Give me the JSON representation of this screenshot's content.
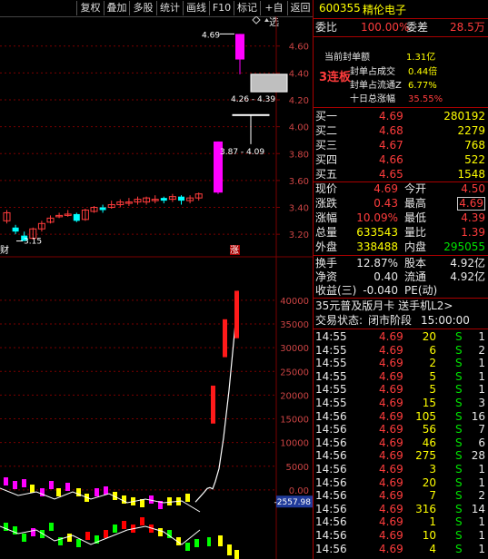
{
  "toolbar": [
    "复权",
    "叠加",
    "多股",
    "统计",
    "画线",
    "F10",
    "标记",
    "+自选",
    "返回"
  ],
  "stock": {
    "code": "600355",
    "name": "精伦电子"
  },
  "weibi": {
    "label": "委比",
    "value": "100.00%",
    "diff_label": "委差",
    "diff": "28.5万"
  },
  "limit": {
    "badge": "3连板",
    "rows": [
      {
        "label": "当前封单额",
        "value": "1.31亿"
      },
      {
        "label": "封单占成交",
        "value": "0.44倍"
      },
      {
        "label": "封单占流通Z",
        "value": "6.77%"
      },
      {
        "label": "十日总涨幅",
        "value": "35.55%"
      }
    ]
  },
  "bids": [
    {
      "label": "买一",
      "price": "4.69",
      "vol": "280192"
    },
    {
      "label": "买二",
      "price": "4.68",
      "vol": "2279"
    },
    {
      "label": "买三",
      "price": "4.67",
      "vol": "768"
    },
    {
      "label": "买四",
      "price": "4.66",
      "vol": "522"
    },
    {
      "label": "买五",
      "price": "4.65",
      "vol": "1548"
    }
  ],
  "quote": [
    {
      "l1": "现价",
      "v1": "4.69",
      "l2": "今开",
      "v2": "4.50"
    },
    {
      "l1": "涨跌",
      "v1": "0.43",
      "l2": "最高",
      "v2": "4.69"
    },
    {
      "l1": "涨幅",
      "v1": "10.09%",
      "l2": "最低",
      "v2": "4.39"
    },
    {
      "l1": "总量",
      "v1": "633543",
      "l2": "量比",
      "v2": "1.39"
    },
    {
      "l1": "外盘",
      "v1": "338488",
      "l2": "内盘",
      "v2": "295055"
    }
  ],
  "fund": [
    {
      "l1": "换手",
      "v1": "12.87%",
      "l2": "股本",
      "v2": "4.92亿"
    },
    {
      "l1": "净资",
      "v1": "0.40",
      "l2": "流通",
      "v2": "4.92亿"
    },
    {
      "l1": "收益(三)",
      "v1": "-0.040",
      "l2": "PE(动)",
      "v2": ""
    }
  ],
  "promo": "35元普及版月卡 送手机L2>",
  "status": {
    "label": "交易状态:",
    "value": "闭市阶段",
    "time": "15:00:00"
  },
  "ticks": [
    {
      "t": "14:55",
      "p": "4.69",
      "v": "20",
      "s": "S",
      "n": "1"
    },
    {
      "t": "14:55",
      "p": "4.69",
      "v": "6",
      "s": "S",
      "n": "2"
    },
    {
      "t": "14:55",
      "p": "4.69",
      "v": "2",
      "s": "S",
      "n": "1"
    },
    {
      "t": "14:55",
      "p": "4.69",
      "v": "5",
      "s": "S",
      "n": "1"
    },
    {
      "t": "14:55",
      "p": "4.69",
      "v": "5",
      "s": "S",
      "n": "1"
    },
    {
      "t": "14:55",
      "p": "4.69",
      "v": "15",
      "s": "S",
      "n": "3"
    },
    {
      "t": "14:56",
      "p": "4.69",
      "v": "105",
      "s": "S",
      "n": "16"
    },
    {
      "t": "14:56",
      "p": "4.69",
      "v": "56",
      "s": "S",
      "n": "7"
    },
    {
      "t": "14:56",
      "p": "4.69",
      "v": "46",
      "s": "S",
      "n": "6"
    },
    {
      "t": "14:56",
      "p": "4.69",
      "v": "275",
      "s": "S",
      "n": "28"
    },
    {
      "t": "14:56",
      "p": "4.69",
      "v": "3",
      "s": "S",
      "n": "1"
    },
    {
      "t": "14:56",
      "p": "4.69",
      "v": "20",
      "s": "S",
      "n": "1"
    },
    {
      "t": "14:56",
      "p": "4.69",
      "v": "7",
      "s": "S",
      "n": "2"
    },
    {
      "t": "14:56",
      "p": "4.69",
      "v": "316",
      "s": "S",
      "n": "14"
    },
    {
      "t": "14:56",
      "p": "4.69",
      "v": "1",
      "s": "S",
      "n": "1"
    },
    {
      "t": "14:56",
      "p": "4.69",
      "v": "10",
      "s": "S",
      "n": "1"
    },
    {
      "t": "14:56",
      "p": "4.69",
      "v": "4",
      "s": "S",
      "n": "1"
    }
  ],
  "chart_data": [
    {
      "type": "candlestick",
      "y_ticks": [
        "4.60",
        "4.40",
        "4.20",
        "4.00",
        "3.80",
        "3.60",
        "3.40",
        "3.20"
      ],
      "ylim": [
        3.12,
        4.74
      ],
      "candles": [
        [
          3.3,
          3.36,
          3.28,
          3.38
        ],
        [
          3.25,
          3.22,
          3.2,
          3.27
        ],
        [
          3.19,
          3.15,
          3.15,
          3.22
        ],
        [
          3.17,
          3.24,
          3.16,
          3.25
        ],
        [
          3.24,
          3.28,
          3.22,
          3.3
        ],
        [
          3.29,
          3.32,
          3.28,
          3.34
        ],
        [
          3.33,
          3.34,
          3.32,
          3.36
        ],
        [
          3.34,
          3.35,
          3.33,
          3.38
        ],
        [
          3.35,
          3.3,
          3.29,
          3.36
        ],
        [
          3.31,
          3.38,
          3.3,
          3.39
        ],
        [
          3.37,
          3.4,
          3.36,
          3.41
        ],
        [
          3.4,
          3.38,
          3.36,
          3.42
        ],
        [
          3.4,
          3.42,
          3.39,
          3.45
        ],
        [
          3.42,
          3.44,
          3.4,
          3.46
        ],
        [
          3.43,
          3.44,
          3.41,
          3.47
        ],
        [
          3.44,
          3.46,
          3.42,
          3.48
        ],
        [
          3.44,
          3.47,
          3.42,
          3.48
        ],
        [
          3.45,
          3.46,
          3.43,
          3.49
        ],
        [
          3.47,
          3.45,
          3.43,
          3.48
        ],
        [
          3.46,
          3.48,
          3.44,
          3.5
        ],
        [
          3.48,
          3.45,
          3.42,
          3.49
        ],
        [
          3.45,
          3.47,
          3.43,
          3.49
        ],
        [
          3.47,
          3.5,
          3.45,
          3.51
        ],
        [
          3.51,
          3.89,
          3.5,
          3.89
        ],
        [
          4.09,
          4.09,
          3.87,
          4.09
        ],
        [
          4.39,
          4.26,
          4.26,
          4.39
        ],
        [
          4.5,
          4.69,
          4.39,
          4.69
        ]
      ],
      "annotations": [
        "4.69",
        "4.26 - 4.39",
        "3.87 - 4.09",
        "3.15"
      ],
      "markers": [
        "财",
        "涨"
      ]
    },
    {
      "type": "line",
      "y_ticks": [
        "40000",
        "35000",
        "30000",
        "25000",
        "20000",
        "15000",
        "10000",
        "5000",
        "0.00"
      ],
      "ylim": [
        -5000,
        44000
      ],
      "current_label": "-2557.98",
      "line_values": [
        -2557.98,
        -1500,
        -400,
        300,
        500,
        200,
        1800,
        4500,
        11000,
        21000,
        33000,
        42000
      ],
      "red_bars": [
        [
          22000,
          14000
        ],
        [
          36000,
          28000
        ],
        [
          42000,
          32000
        ]
      ]
    }
  ],
  "colors": {
    "up": "#ff3c3c",
    "down": "#00ffff",
    "bg": "#000000",
    "grid": "#7a0000",
    "limit_up": "#ff00ff"
  }
}
